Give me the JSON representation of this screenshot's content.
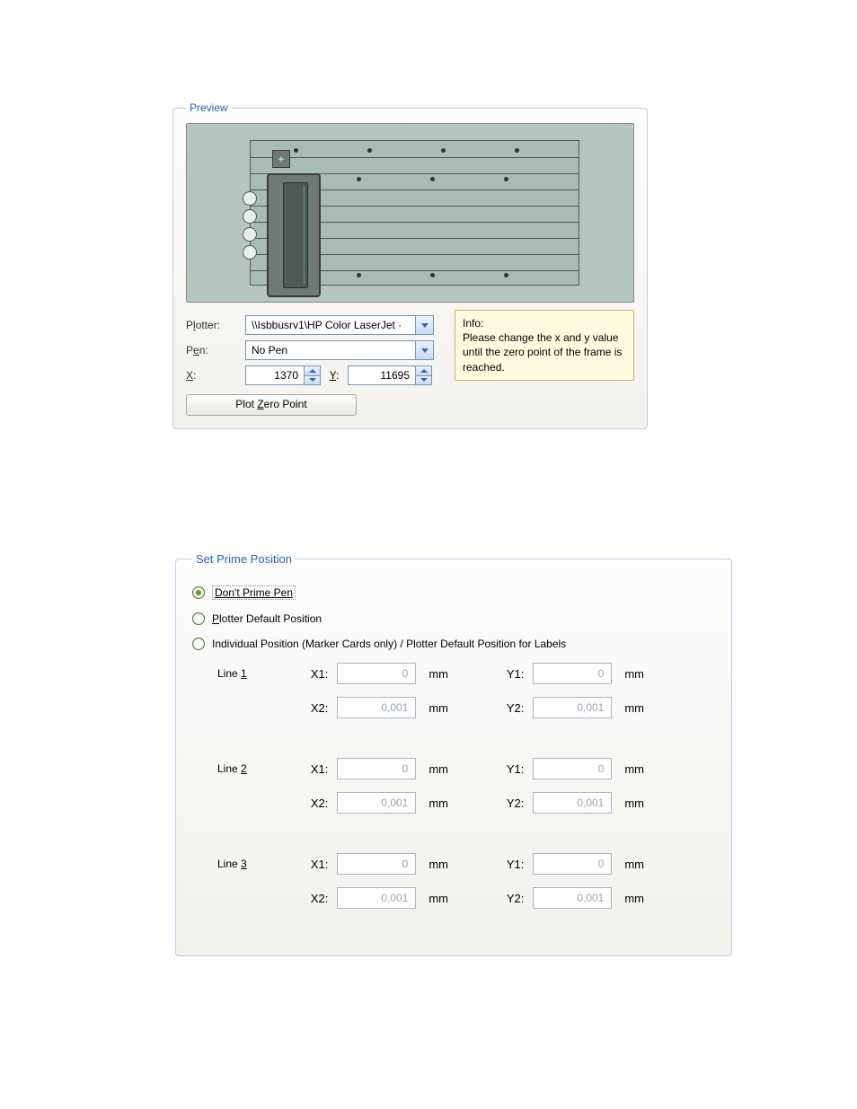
{
  "preview": {
    "legend": "Preview",
    "plotter_label_pre": "P",
    "plotter_label_u": "l",
    "plotter_label_post": "otter:",
    "plotter_value": "\\\\Isbbusrv1\\HP Color LaserJet ·",
    "pen_label_pre": "P",
    "pen_label_u": "e",
    "pen_label_post": "n:",
    "pen_value": "No Pen",
    "x_label": "X",
    "x_colon": ":",
    "x_value": "1370",
    "y_label": "Y",
    "y_colon": ":",
    "y_value": "11695",
    "info_title": "Info:",
    "info_text": "Please change the x and y value until the zero point of the frame is reached.",
    "plot_button_pre": "Plot ",
    "plot_button_u": "Z",
    "plot_button_post": "ero Point"
  },
  "prime": {
    "legend": "Set Prime Position",
    "opt1_pre": "D",
    "opt1_u": "o",
    "opt1_post": "n't Prime Pen",
    "opt2_pre": "",
    "opt2_u": "P",
    "opt2_post": "lotter Default Position",
    "opt3": "Individual Position (Marker Cards only) / Plotter Default Position for Labels",
    "lines": [
      {
        "label_pre": "Line ",
        "label_u": "1",
        "x1": "0",
        "x2": "0,001",
        "y1": "0",
        "y2": "0,001"
      },
      {
        "label_pre": "Line ",
        "label_u": "2",
        "x1": "0",
        "x2": "0,001",
        "y1": "0",
        "y2": "0,001"
      },
      {
        "label_pre": "Line ",
        "label_u": "3",
        "x1": "0",
        "x2": "0,001",
        "y1": "0",
        "y2": "0,001"
      }
    ],
    "labels": {
      "x1": "X1:",
      "x2": "X2:",
      "y1": "Y1:",
      "y2": "Y2:",
      "unit": "mm"
    }
  }
}
